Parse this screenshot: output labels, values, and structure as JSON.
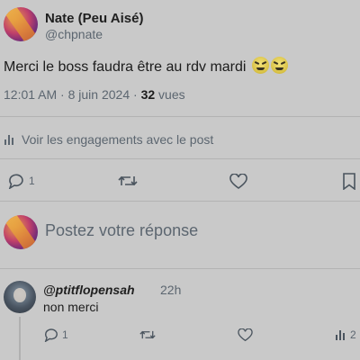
{
  "post": {
    "author_name": "Nate (Peu Aisé)",
    "author_handle": "@chpnate",
    "text": "Merci le boss faudra être au rdv mardi",
    "emojis": [
      "face-with-horns-icon",
      "face-with-horns-icon"
    ],
    "time": "12:01 AM",
    "date": "8 juin 2024",
    "views_count": "32",
    "views_label": "vues",
    "engagements_label": "Voir les engagements avec le post",
    "actions": {
      "reply_count": "1",
      "repost_count": "",
      "like_count": ""
    }
  },
  "composer": {
    "placeholder": "Postez votre réponse"
  },
  "reply": {
    "author_handle": "@ptitflopensah",
    "time_ago": "22h",
    "text": "non merci",
    "actions": {
      "reply_count": "1",
      "views_count": "2"
    }
  },
  "colors": {
    "background": "#c9c9c9",
    "secondary_text": "#5c6670",
    "divider": "#b3b3b3"
  }
}
